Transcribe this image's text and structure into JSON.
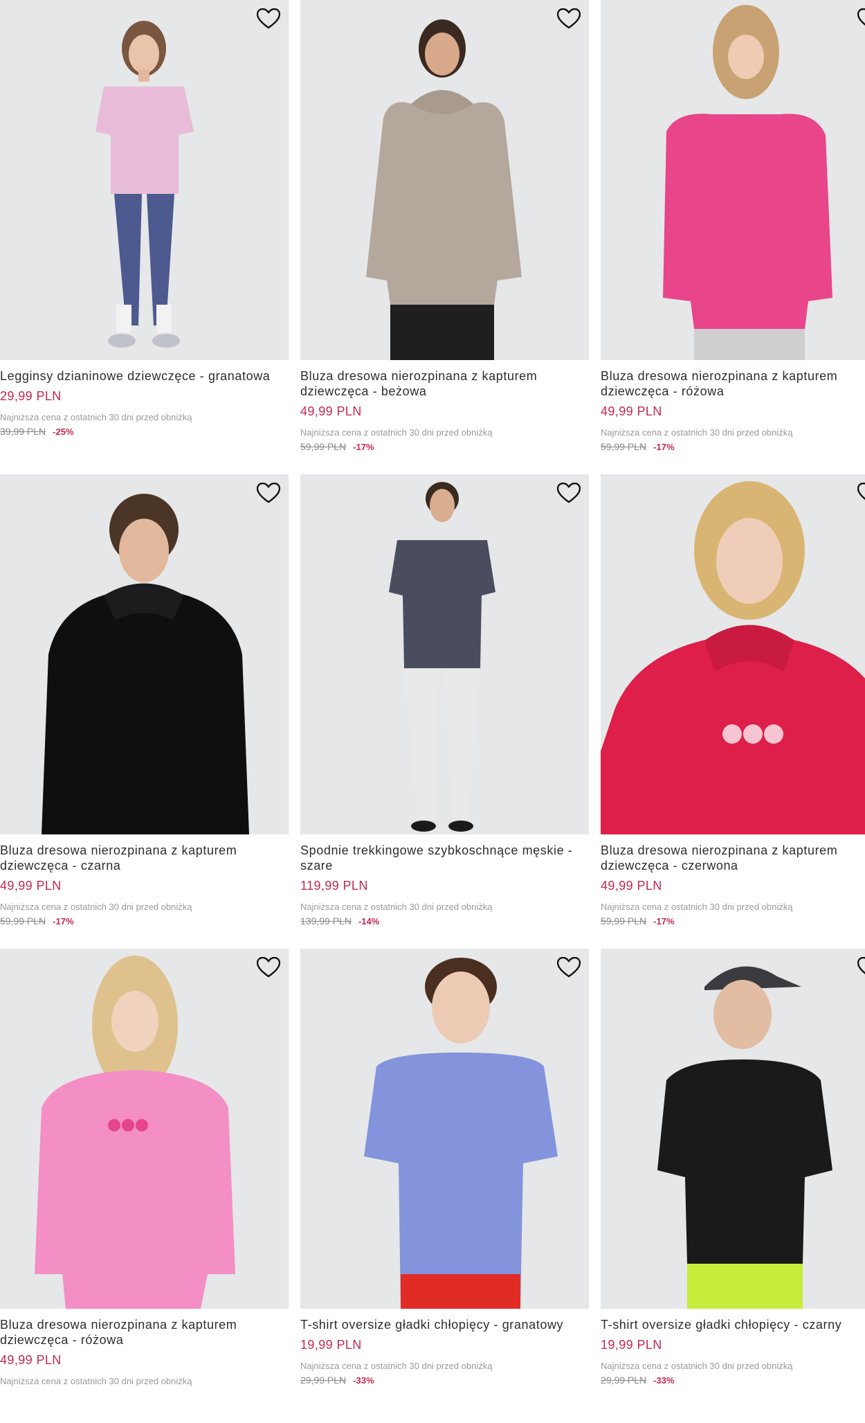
{
  "colors": {
    "price": "#c4284f",
    "photo_bg": "#e6e7e8",
    "text": "#2d2d2d",
    "muted": "#9a9a9a"
  },
  "products": [
    {
      "title": "Legginsy dzianinowe dziewczęce - granatowa",
      "price": "29,99 PLN",
      "lowest_note": "Najniższa cena z ostatnich 30 dni przed obniżką",
      "old_price": "39,99 PLN",
      "discount": "-25%",
      "icon": "heart-outline-icon"
    },
    {
      "title": "Bluza dresowa nierozpinana z kapturem dziewczęca - beżowa",
      "price": "49,99 PLN",
      "lowest_note": "Najniższa cena z ostatnich 30 dni przed obniżką",
      "old_price": "59,99 PLN",
      "discount": "-17%",
      "icon": "heart-outline-icon"
    },
    {
      "title": "Bluza dresowa nierozpinana z kapturem dziewczęca - różowa",
      "price": "49,99 PLN",
      "lowest_note": "Najniższa cena z ostatnich 30 dni przed obniżką",
      "old_price": "59,99 PLN",
      "discount": "-17%",
      "icon": "heart-outline-icon"
    },
    {
      "title": "Bluza dresowa nierozpinana z kapturem dziewczęca - czarna",
      "price": "49,99 PLN",
      "lowest_note": "Najniższa cena z ostatnich 30 dni przed obniżką",
      "old_price": "59,99 PLN",
      "discount": "-17%",
      "icon": "heart-outline-icon"
    },
    {
      "title": "Spodnie trekkingowe szybkoschnące męskie - szare",
      "price": "119,99 PLN",
      "lowest_note": "Najniższa cena z ostatnich 30 dni przed obniżką",
      "old_price": "139,99 PLN",
      "discount": "-14%",
      "icon": "heart-outline-icon"
    },
    {
      "title": "Bluza dresowa nierozpinana z kapturem dziewczęca - czerwona",
      "price": "49,99 PLN",
      "lowest_note": "Najniższa cena z ostatnich 30 dni przed obniżką",
      "old_price": "59,99 PLN",
      "discount": "-17%",
      "icon": "heart-outline-icon"
    },
    {
      "title": "Bluza dresowa nierozpinana z kapturem dziewczęca - różowa",
      "price": "49,99 PLN",
      "lowest_note": "Najniższa cena z ostatnich 30 dni przed obniżką",
      "old_price": "",
      "discount": "",
      "icon": "heart-outline-icon"
    },
    {
      "title": "T-shirt oversize gładki chłopięcy - granatowy",
      "price": "19,99 PLN",
      "lowest_note": "Najniższa cena z ostatnich 30 dni przed obniżką",
      "old_price": "29,99 PLN",
      "discount": "-33%",
      "icon": "heart-outline-icon"
    },
    {
      "title": "T-shirt oversize gładki chłopięcy - czarny",
      "price": "19,99 PLN",
      "lowest_note": "Najniższa cena z ostatnich 30 dni przed obniżką",
      "old_price": "29,99 PLN",
      "discount": "-33%",
      "icon": "heart-outline-icon"
    }
  ]
}
